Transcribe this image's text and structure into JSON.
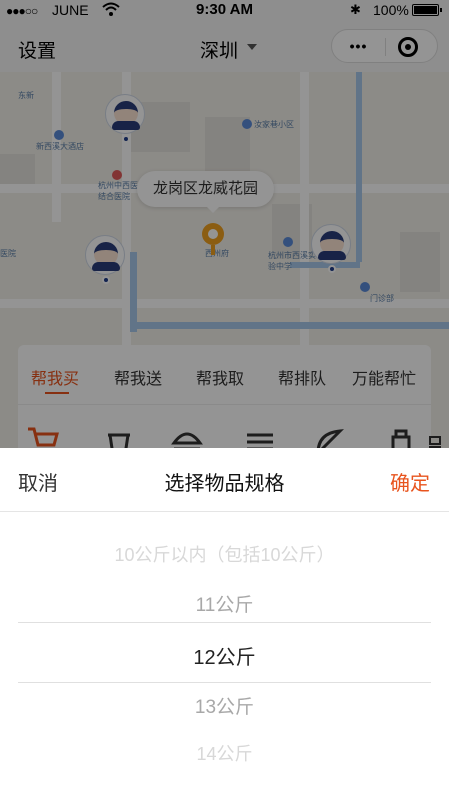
{
  "status_bar": {
    "signal": "●●●○○",
    "carrier": "JUNE",
    "time": "9:30 AM",
    "bluetooth": "✱",
    "battery": "100%"
  },
  "nav": {
    "settings": "设置",
    "city": "深圳",
    "more": "•••"
  },
  "map": {
    "bubble": "龙岗区龙威花园",
    "pois": [
      "东新",
      "新西溪大酒店",
      "汝家巷小区",
      "杭州中西医结合医院",
      "杭州市西溪实验中学",
      "门诊部",
      "西州府",
      "医院"
    ]
  },
  "service_tabs": [
    "帮我买",
    "帮我送",
    "帮我取",
    "帮排队",
    "万能帮忙"
  ],
  "active_tab_index": 0,
  "picker": {
    "cancel": "取消",
    "title": "选择物品规格",
    "confirm": "确定",
    "options": [
      "10公斤以内（包括10公斤）",
      "11公斤",
      "12公斤",
      "13公斤",
      "14公斤"
    ],
    "selected_index": 2
  },
  "colors": {
    "accent": "#e8541e",
    "map_water": "#a8c8ea",
    "avatar_blue": "#2a3d7a",
    "pin_orange": "#f0a020"
  }
}
